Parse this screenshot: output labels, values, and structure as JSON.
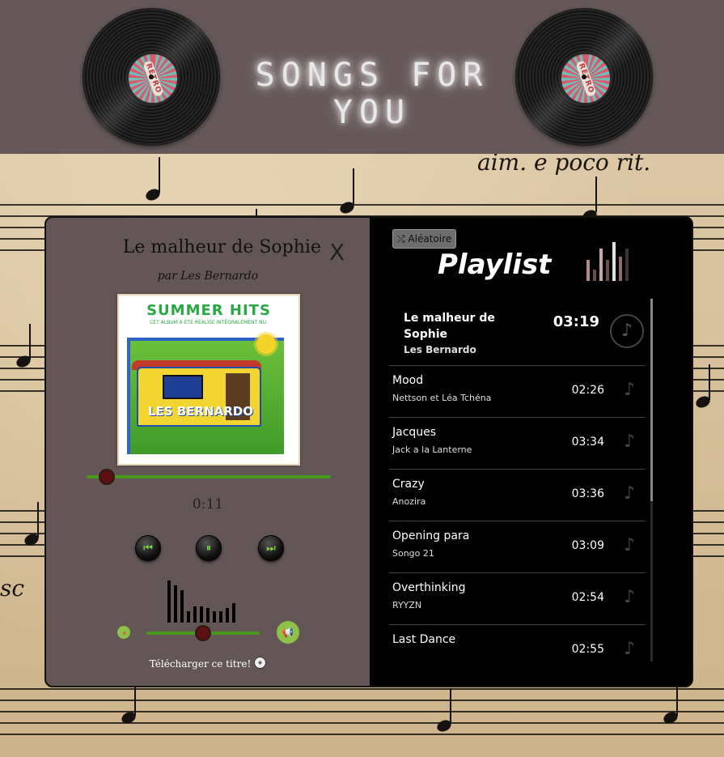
{
  "header": {
    "title": "SONGS FOR YOU",
    "vinyl_label": "RETRO"
  },
  "now_playing": {
    "title": "Le malheur de Sophie",
    "artist": "par Les Bernardo",
    "close_icon": "X",
    "elapsed": "0:11",
    "progress_fraction": 0.08,
    "volume_fraction": 0.49,
    "cover": {
      "heading": "SUMMER HITS",
      "subheading": "CET ALBUM A ÉTÉ RÉALISÉ INTÉGRALEMENT NU.",
      "band": "LES BERNARDO"
    },
    "download_label": "Télécharger ce titre!",
    "controls": {
      "prev_icon": "skip-previous-icon",
      "pause_icon": "pause-icon",
      "next_icon": "skip-next-icon"
    }
  },
  "playlist": {
    "shuffle_label": "⤭ Aléatoire",
    "title": "Playlist",
    "tracks": [
      {
        "name": "Le malheur de Sophie",
        "artist": "Les Bernardo",
        "duration": "03:19",
        "active": true
      },
      {
        "name": "Mood",
        "artist": "Nettson et Léa Tchéna",
        "duration": "02:26"
      },
      {
        "name": "Jacques",
        "artist": "Jack a la Lanterne",
        "duration": "03:34"
      },
      {
        "name": "Crazy",
        "artist": "Anozira",
        "duration": "03:36"
      },
      {
        "name": "Opening para",
        "artist": "Songo 21",
        "duration": "03:09"
      },
      {
        "name": "Overthinking",
        "artist": "RYYZN",
        "duration": "02:54"
      },
      {
        "name": "Last Dance",
        "artist": "",
        "duration": "02:55"
      }
    ]
  },
  "colors": {
    "header_bg": "#665859",
    "panel_bg": "#645657",
    "accent_green": "#46971c",
    "knob": "#5e0f0f"
  }
}
